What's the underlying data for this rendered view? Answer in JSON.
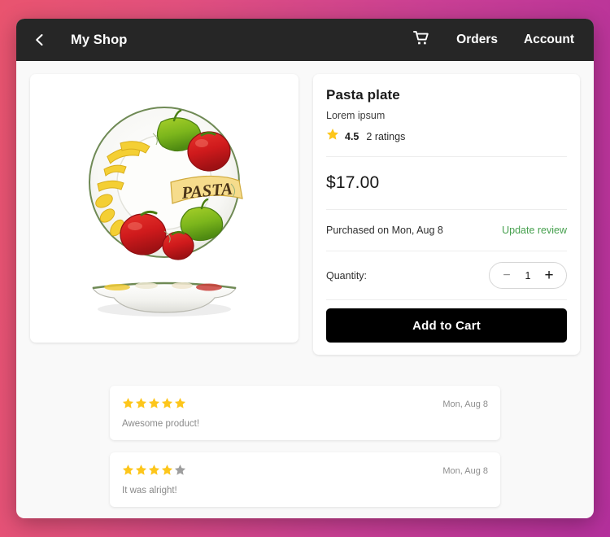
{
  "theme": {
    "bg_gradient_from": "#e9546f",
    "bg_gradient_to": "#b4309c",
    "appbar_bg": "#262626",
    "page_bg": "#f9f9f9",
    "card_bg": "#ffffff",
    "star_gold": "#fdc61b",
    "star_gray": "#9e9e9e",
    "link_green": "#46a04e",
    "button_black": "#000000"
  },
  "appbar": {
    "back_icon": "chevron-left-icon",
    "title": "My Shop",
    "cart_icon": "shopping-cart-icon",
    "orders_label": "Orders",
    "account_label": "Account"
  },
  "product": {
    "image_alt": "Hand painted pasta plate with tomatoes, peppers and pasta, shown top view and side view",
    "image_label": "PASTA",
    "title": "Pasta plate",
    "subtitle": "Lorem ipsum",
    "rating_icon": "star-icon",
    "rating_value": "4.5",
    "rating_count": "2 ratings",
    "price": "$17.00",
    "purchased_text": "Purchased on Mon, Aug 8",
    "update_review_label": "Update review",
    "quantity_label": "Quantity:",
    "quantity_value": "1",
    "decrement_label": "−",
    "increment_label": "+",
    "add_to_cart_label": "Add to Cart"
  },
  "reviews": [
    {
      "stars_filled": 5,
      "stars_total": 5,
      "date": "Mon, Aug 8",
      "text": "Awesome product!"
    },
    {
      "stars_filled": 4,
      "stars_total": 5,
      "date": "Mon, Aug 8",
      "text": "It was alright!"
    }
  ]
}
